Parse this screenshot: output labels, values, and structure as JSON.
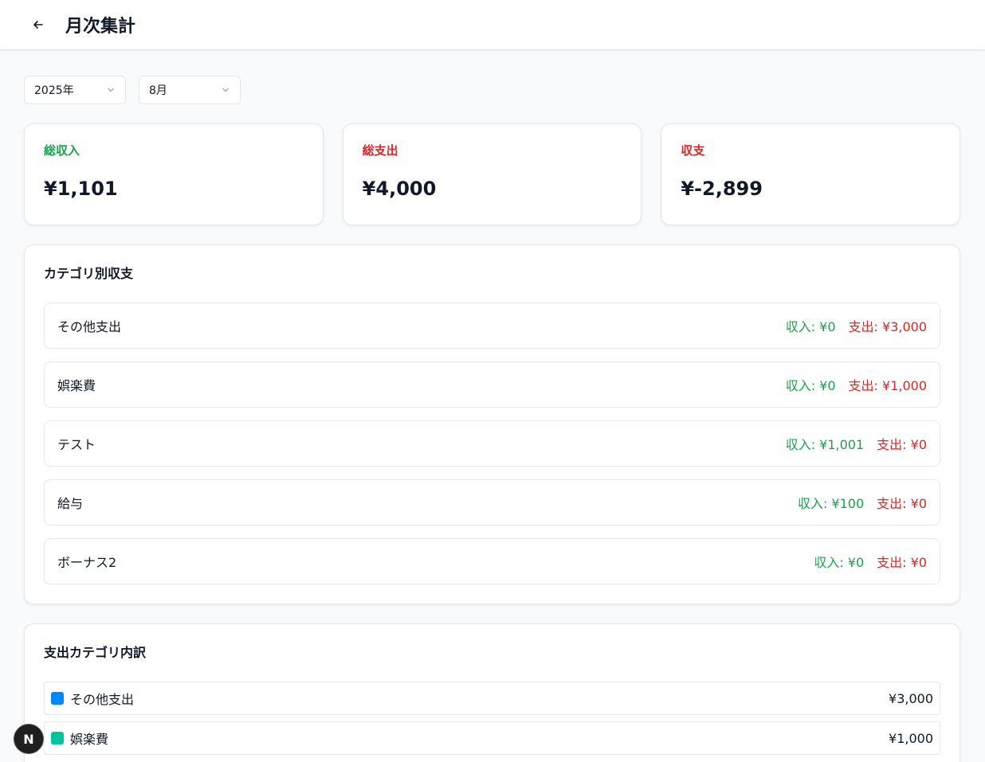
{
  "header": {
    "title": "月次集計",
    "back_icon": "arrow-left-icon"
  },
  "filters": {
    "year": "2025年",
    "month": "8月"
  },
  "summary": [
    {
      "label": "総収入",
      "value": "¥1,101",
      "color": "#16a34a"
    },
    {
      "label": "総支出",
      "value": "¥4,000",
      "color": "#dc2626"
    },
    {
      "label": "収支",
      "value": "¥-2,899",
      "color": "#dc2626"
    }
  ],
  "category_section": {
    "title": "カテゴリ別収支",
    "rows": [
      {
        "name": "その他支出",
        "income": "収入: ¥0",
        "expense": "支出: ¥3,000"
      },
      {
        "name": "娯楽費",
        "income": "収入: ¥0",
        "expense": "支出: ¥1,000"
      },
      {
        "name": "テスト",
        "income": "収入: ¥1,001",
        "expense": "支出: ¥0"
      },
      {
        "name": "給与",
        "income": "収入: ¥100",
        "expense": "支出: ¥0"
      },
      {
        "name": "ボーナス2",
        "income": "収入: ¥0",
        "expense": "支出: ¥0"
      }
    ]
  },
  "breakdown_section": {
    "title": "支出カテゴリ内訳",
    "rows": [
      {
        "name": "その他支出",
        "amount": "¥3,000",
        "color": "#0088fe"
      },
      {
        "name": "娯楽費",
        "amount": "¥1,000",
        "color": "#00c49f"
      }
    ]
  },
  "colors": {
    "income": "#16a34a",
    "expense": "#dc2626"
  },
  "badge": {
    "label": "N"
  }
}
